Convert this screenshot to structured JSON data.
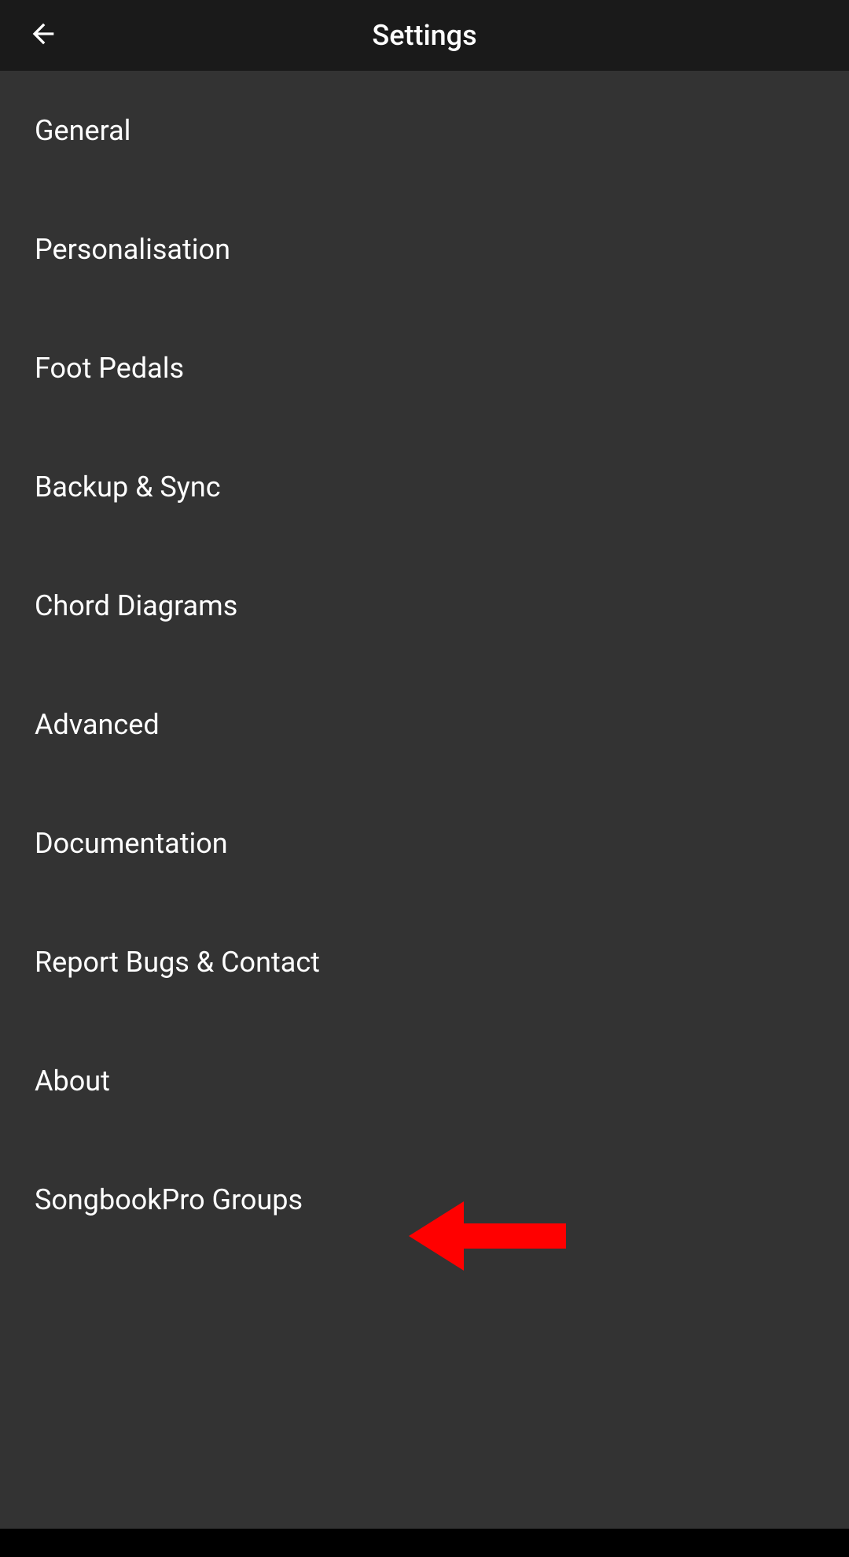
{
  "header": {
    "title": "Settings"
  },
  "menu": {
    "items": [
      {
        "label": "General",
        "name": "settings-item-general"
      },
      {
        "label": "Personalisation",
        "name": "settings-item-personalisation"
      },
      {
        "label": "Foot Pedals",
        "name": "settings-item-foot-pedals"
      },
      {
        "label": "Backup & Sync",
        "name": "settings-item-backup-sync"
      },
      {
        "label": "Chord Diagrams",
        "name": "settings-item-chord-diagrams"
      },
      {
        "label": "Advanced",
        "name": "settings-item-advanced"
      },
      {
        "label": "Documentation",
        "name": "settings-item-documentation"
      },
      {
        "label": "Report Bugs & Contact",
        "name": "settings-item-report-bugs"
      },
      {
        "label": "About",
        "name": "settings-item-about"
      },
      {
        "label": "SongbookPro Groups",
        "name": "settings-item-songbookpro-groups"
      }
    ]
  },
  "annotation": {
    "arrow_color": "#ff0000"
  }
}
